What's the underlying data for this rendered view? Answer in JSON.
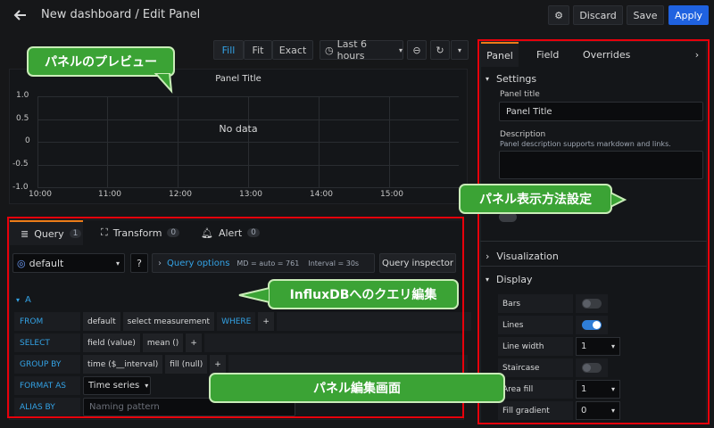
{
  "header": {
    "title": "New dashboard / Edit Panel",
    "discard_label": "Discard",
    "save_label": "Save",
    "apply_label": "Apply"
  },
  "panel_options": {
    "fill_label": "Fill",
    "fit_label": "Fit",
    "exact_label": "Exact",
    "time_range": "Last 6 hours"
  },
  "preview": {
    "panel_title": "Panel Title",
    "no_data": "No data",
    "y_ticks": [
      "1.0",
      "0.5",
      "0",
      "-0.5",
      "-1.0"
    ],
    "x_ticks": [
      "10:00",
      "11:00",
      "12:00",
      "13:00",
      "14:00",
      "15:00"
    ]
  },
  "query_tabs": [
    {
      "label": "Query",
      "count": "1"
    },
    {
      "label": "Transform",
      "count": "0"
    },
    {
      "label": "Alert",
      "count": "0"
    }
  ],
  "datasource": {
    "name": "default",
    "query_options_label": "Query options",
    "md_info": "MD = auto = 761",
    "interval_info": "Interval = 30s",
    "inspector_label": "Query inspector"
  },
  "query": {
    "ref_id": "A",
    "from_label": "FROM",
    "from_default": "default",
    "from_measurement": "select measurement",
    "where_label": "WHERE",
    "select_label": "SELECT",
    "select_field": "field (value)",
    "select_mean": "mean ()",
    "group_by_label": "GROUP BY",
    "group_time": "time ($__interval)",
    "group_fill": "fill (null)",
    "format_label": "FORMAT AS",
    "format_value": "Time series",
    "alias_label": "ALIAS BY",
    "alias_placeholder": "Naming pattern",
    "plus": "+"
  },
  "side": {
    "tabs": [
      "Panel",
      "Field",
      "Overrides"
    ],
    "settings_label": "Settings",
    "panel_title_label": "Panel title",
    "panel_title_value": "Panel Title",
    "description_label": "Description",
    "description_hint": "Panel description supports markdown and links.",
    "visualization_label": "Visualization",
    "display_label": "Display",
    "display_rows": [
      {
        "label": "Bars",
        "type": "toggle",
        "on": false
      },
      {
        "label": "Lines",
        "type": "toggle",
        "on": true
      },
      {
        "label": "Line width",
        "type": "select",
        "value": "1"
      },
      {
        "label": "Staircase",
        "type": "toggle",
        "on": false
      },
      {
        "label": "Area fill",
        "type": "select",
        "value": "1"
      },
      {
        "label": "Fill gradient",
        "type": "select",
        "value": "0"
      }
    ]
  },
  "callouts": {
    "preview": "パネルのプレビュー",
    "display_settings": "パネル表示方法設定",
    "query_edit": "InfluxDBへのクエリ編集",
    "panel_edit": "パネル編集画面"
  },
  "colors": {
    "accent": "#1f62e0",
    "annotation_red": "#e8000b",
    "callout_green": "#3ba335"
  }
}
